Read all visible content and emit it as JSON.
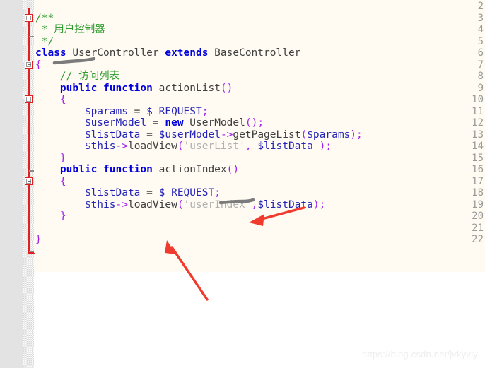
{
  "editor": {
    "background_code": "#FFFBF2",
    "background_page": "#FFFFFF",
    "gutter_color": "#E3E3E3",
    "fold_rail_color": "#E02020",
    "line_numbers": [
      "2",
      "3",
      "4",
      "5",
      "6",
      "7",
      "8",
      "9",
      "10",
      "11",
      "12",
      "13",
      "14",
      "15",
      "16",
      "17",
      "18",
      "19",
      "20",
      "21",
      "22"
    ],
    "lines": [
      {
        "number": "2",
        "tokens": []
      },
      {
        "number": "3",
        "tokens": [
          {
            "t": "/**",
            "c": "cmt"
          }
        ]
      },
      {
        "number": "4",
        "tokens": [
          {
            "t": " * ",
            "c": "cmt"
          },
          {
            "t": "用户控制器",
            "c": "cmtcn"
          }
        ]
      },
      {
        "number": "5",
        "tokens": [
          {
            "t": " */",
            "c": "cmt"
          }
        ]
      },
      {
        "number": "6",
        "tokens": [
          {
            "t": "class",
            "c": "kw"
          },
          {
            "t": " UserController ",
            "c": "ident"
          },
          {
            "t": "extends",
            "c": "kw"
          },
          {
            "t": " BaseController",
            "c": "ident"
          }
        ]
      },
      {
        "number": "7",
        "tokens": [
          {
            "t": "{",
            "c": "punc"
          }
        ]
      },
      {
        "number": "8",
        "tokens": [
          {
            "t": "    // ",
            "c": "cmt"
          },
          {
            "t": "访问列表",
            "c": "cmtcn"
          }
        ]
      },
      {
        "number": "9",
        "tokens": [
          {
            "t": "    ",
            "c": "plain"
          },
          {
            "t": "public function",
            "c": "kw"
          },
          {
            "t": " actionList",
            "c": "ident"
          },
          {
            "t": "()",
            "c": "punc"
          }
        ]
      },
      {
        "number": "10",
        "tokens": [
          {
            "t": "    {",
            "c": "punc"
          }
        ]
      },
      {
        "number": "11",
        "tokens": [
          {
            "t": "        ",
            "c": "plain"
          },
          {
            "t": "$params",
            "c": "var"
          },
          {
            "t": " = ",
            "c": "plain"
          },
          {
            "t": "$_REQUEST",
            "c": "var"
          },
          {
            "t": ";",
            "c": "punc"
          }
        ]
      },
      {
        "number": "12",
        "tokens": [
          {
            "t": "        ",
            "c": "plain"
          },
          {
            "t": "$userModel",
            "c": "var"
          },
          {
            "t": " = ",
            "c": "plain"
          },
          {
            "t": "new",
            "c": "kw"
          },
          {
            "t": " UserModel",
            "c": "ident"
          },
          {
            "t": "();",
            "c": "punc"
          }
        ]
      },
      {
        "number": "13",
        "tokens": [
          {
            "t": "        ",
            "c": "plain"
          },
          {
            "t": "$listData",
            "c": "var"
          },
          {
            "t": " = ",
            "c": "plain"
          },
          {
            "t": "$userModel",
            "c": "var"
          },
          {
            "t": "->",
            "c": "op"
          },
          {
            "t": "getPageList",
            "c": "ident"
          },
          {
            "t": "(",
            "c": "punc"
          },
          {
            "t": "$params",
            "c": "var"
          },
          {
            "t": ");",
            "c": "punc"
          }
        ]
      },
      {
        "number": "14",
        "tokens": [
          {
            "t": "        ",
            "c": "plain"
          },
          {
            "t": "$this",
            "c": "var"
          },
          {
            "t": "->",
            "c": "op"
          },
          {
            "t": "loadView",
            "c": "ident"
          },
          {
            "t": "(",
            "c": "punc"
          },
          {
            "t": "'userList'",
            "c": "str"
          },
          {
            "t": ", ",
            "c": "punc"
          },
          {
            "t": "$listData",
            "c": "var"
          },
          {
            "t": " );",
            "c": "punc"
          }
        ]
      },
      {
        "number": "15",
        "tokens": [
          {
            "t": "    }",
            "c": "punc"
          }
        ]
      },
      {
        "number": "16",
        "tokens": [
          {
            "t": "    ",
            "c": "plain"
          },
          {
            "t": "public function",
            "c": "kw"
          },
          {
            "t": " actionIndex",
            "c": "ident"
          },
          {
            "t": "()",
            "c": "punc"
          }
        ]
      },
      {
        "number": "17",
        "tokens": [
          {
            "t": "    {",
            "c": "punc"
          }
        ]
      },
      {
        "number": "18",
        "tokens": [
          {
            "t": "        ",
            "c": "plain"
          },
          {
            "t": "$listData",
            "c": "var"
          },
          {
            "t": " = ",
            "c": "plain"
          },
          {
            "t": "$_REQUEST",
            "c": "var"
          },
          {
            "t": ";",
            "c": "punc"
          }
        ]
      },
      {
        "number": "19",
        "tokens": [
          {
            "t": "        ",
            "c": "plain"
          },
          {
            "t": "$this",
            "c": "var"
          },
          {
            "t": "->",
            "c": "op"
          },
          {
            "t": "loadView",
            "c": "ident"
          },
          {
            "t": "(",
            "c": "punc"
          },
          {
            "t": "'userIndex'",
            "c": "str"
          },
          {
            "t": ",",
            "c": "punc"
          },
          {
            "t": "$listData",
            "c": "var"
          },
          {
            "t": ");",
            "c": "punc"
          }
        ]
      },
      {
        "number": "20",
        "tokens": [
          {
            "t": "    }",
            "c": "punc"
          }
        ]
      },
      {
        "number": "21",
        "tokens": []
      },
      {
        "number": "22",
        "tokens": [
          {
            "t": "}",
            "c": "punc"
          }
        ]
      }
    ],
    "fold_markers": [
      {
        "line": "3",
        "state": "expanded"
      },
      {
        "line": "7",
        "state": "expanded"
      },
      {
        "line": "10",
        "state": "expanded"
      },
      {
        "line": "17",
        "state": "expanded"
      }
    ],
    "full_code": "/**\n * 用户控制器\n */\nclass UserController extends BaseController\n{\n    // 访问列表\n    public function actionList()\n    {\n        $params = $_REQUEST;\n        $userModel = new UserModel();\n        $listData = $userModel->getPageList($params);\n        $this->loadView('userList', $listData );\n    }\n    public function actionIndex()\n    {\n        $listData = $_REQUEST;\n        $this->loadView('userIndex',$listData);\n    }\n}"
  },
  "annotations": {
    "color_arrow": "#F03A2E",
    "color_underline": "#808080",
    "underlines": [
      {
        "target": "UserController",
        "label": "class-name-underline"
      },
      {
        "target": "actionIndex",
        "label": "method-name-underline"
      }
    ],
    "arrows": [
      {
        "label": "arrow-to-request",
        "points_at": "$_REQUEST"
      },
      {
        "label": "arrow-to-loadview",
        "points_at": "loadView"
      }
    ]
  },
  "watermark": {
    "text": "https://blog.csdn.net/jvkyvly"
  }
}
